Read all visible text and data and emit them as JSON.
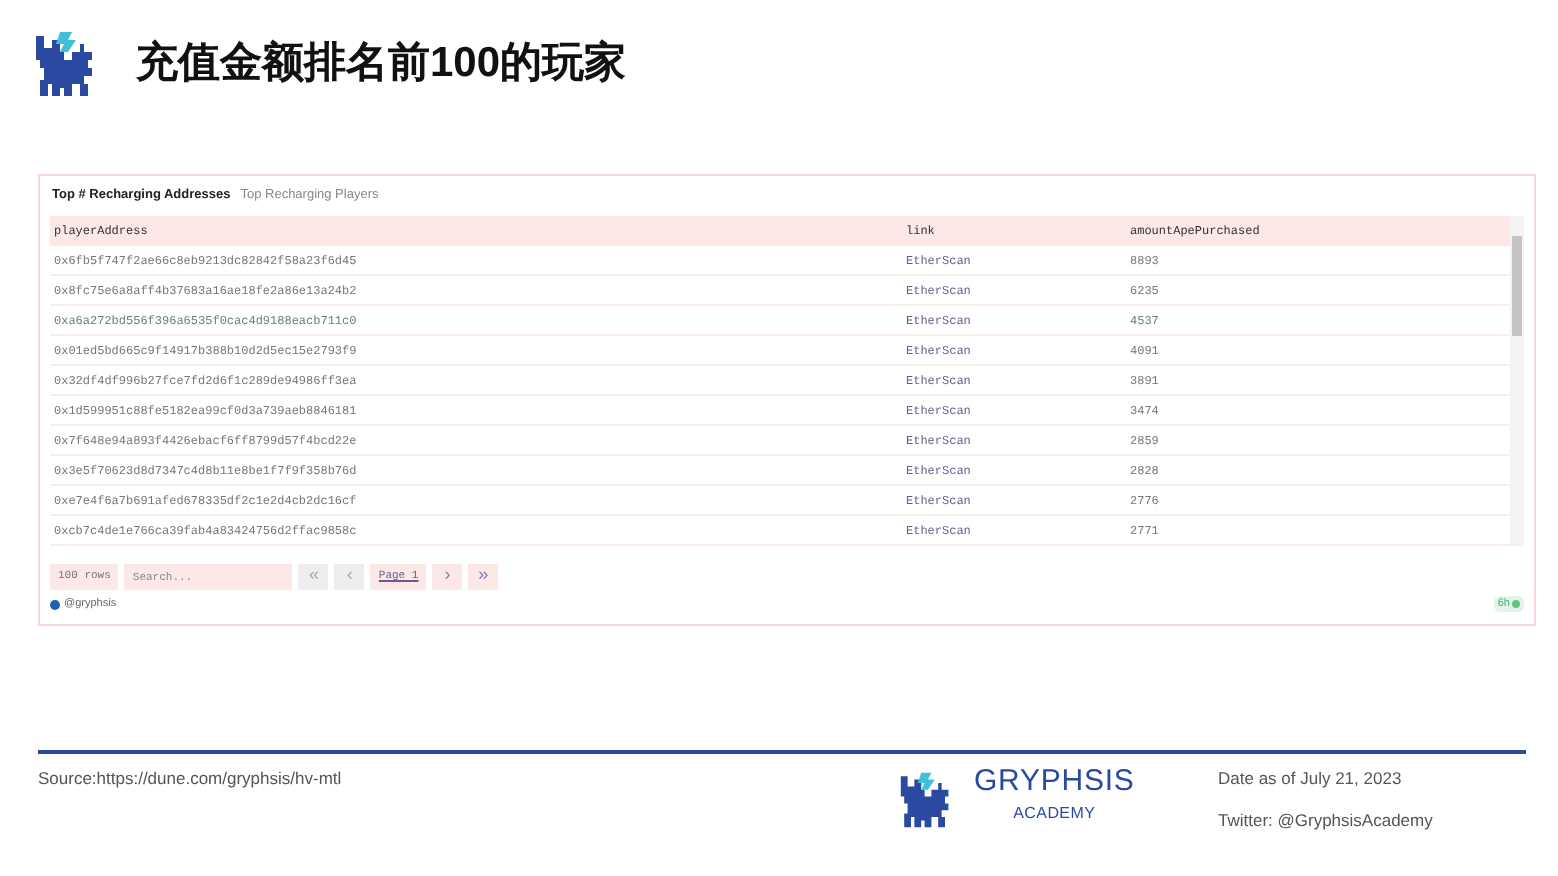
{
  "title": "充值金额排名前100的玩家",
  "tabs": [
    {
      "label": "Top # Recharging Addresses",
      "selected": true
    },
    {
      "label": "Top Recharging Players",
      "selected": false
    }
  ],
  "table": {
    "columns": [
      "playerAddress",
      "link",
      "amountApePurchased"
    ],
    "rows": [
      [
        "0x6fb5f747f2ae66c8eb9213dc82842f58a23f6d45",
        "EtherScan",
        "8893"
      ],
      [
        "0x8fc75e6a8aff4b37683a16ae18fe2a86e13a24b2",
        "EtherScan",
        "6235"
      ],
      [
        "0xa6a272bd556f396a6535f0cac4d9188eacb711c0",
        "EtherScan",
        "4537"
      ],
      [
        "0x01ed5bd665c9f14917b388b10d2d5ec15e2793f9",
        "EtherScan",
        "4091"
      ],
      [
        "0x32df4df996b27fce7fd2d6f1c289de94986ff3ea",
        "EtherScan",
        "3891"
      ],
      [
        "0x1d599951c88fe5182ea99cf0d3a739aeb8846181",
        "EtherScan",
        "3474"
      ],
      [
        "0x7f648e94a893f4426ebacf6ff8799d57f4bcd22e",
        "EtherScan",
        "2859"
      ],
      [
        "0x3e5f70623d8d7347c4d8b11e8be1f7f9f358b76d",
        "EtherScan",
        "2828"
      ],
      [
        "0xe7e4f6a7b691afed678335df2c1e2d4cb2dc16cf",
        "EtherScan",
        "2776"
      ],
      [
        "0xcb7c4de1e766ca39fab4a83424756d2ffac9858c",
        "EtherScan",
        "2771"
      ]
    ]
  },
  "pager": {
    "rows_label": "100 rows",
    "search_placeholder": "Search...",
    "buttons": [
      {
        "label": "«",
        "disabled": true
      },
      {
        "label": "‹",
        "disabled": true
      },
      {
        "label": "Page 1",
        "kind": "page"
      },
      {
        "label": "›",
        "disabled": false
      },
      {
        "label": "»",
        "disabled": false
      }
    ]
  },
  "author": "@gryphsis",
  "freshness": "6h",
  "footer": {
    "source": "Source:https://dune.com/gryphsis/hv-mtl",
    "brand": "GRYPHSIS",
    "brand_sub": "ACADEMY",
    "date": "Date as of July 21, 2023",
    "twitter": "Twitter: @GryphsisAcademy"
  }
}
